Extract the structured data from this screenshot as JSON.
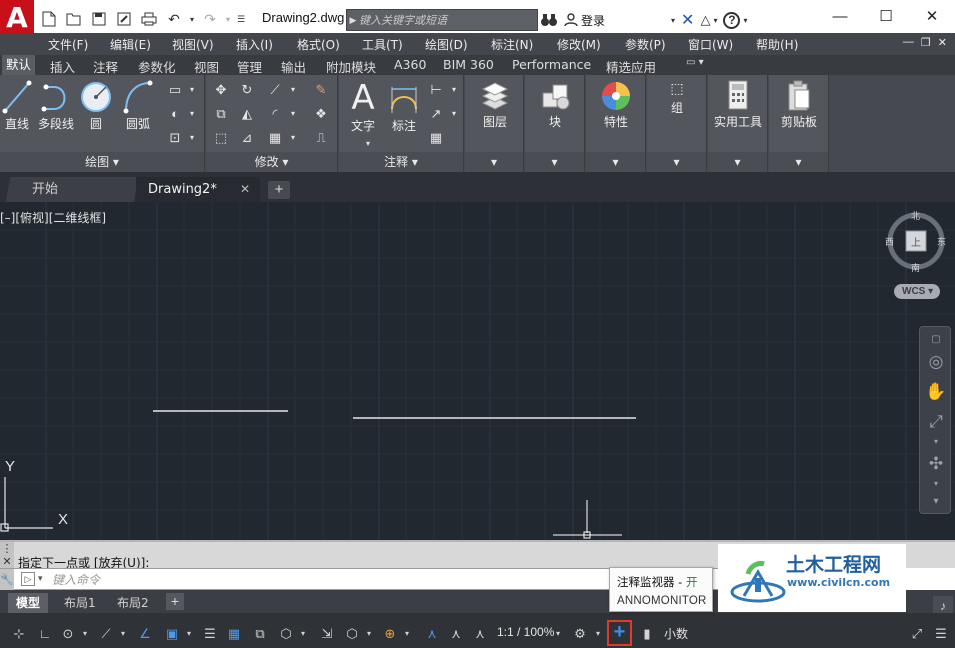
{
  "titlebar": {
    "app_logo": "A",
    "document_title": "Drawing2.dwg",
    "search_placeholder": "键入关键字或短语",
    "login_label": "登录",
    "help_label": "?"
  },
  "menubar": {
    "items": [
      "文件(F)",
      "编辑(E)",
      "视图(V)",
      "插入(I)",
      "格式(O)",
      "工具(T)",
      "绘图(D)",
      "标注(N)",
      "修改(M)",
      "参数(P)",
      "窗口(W)",
      "帮助(H)"
    ]
  },
  "ribbon_tabs": [
    "默认",
    "插入",
    "注释",
    "参数化",
    "视图",
    "管理",
    "输出",
    "附加模块",
    "A360",
    "BIM 360",
    "Performance",
    "精选应用"
  ],
  "ribbon": {
    "draw_panel": {
      "title": "绘图",
      "tools": [
        "直线",
        "多段线",
        "圆",
        "圆弧"
      ]
    },
    "modify_panel": {
      "title": "修改"
    },
    "annotation_panel": {
      "title": "注释",
      "tools": [
        "文字",
        "标注"
      ]
    },
    "layers": "图层",
    "block": "块",
    "properties": "特性",
    "group": "组",
    "utilities": "实用工具",
    "clipboard": "剪贴板"
  },
  "file_tabs": {
    "start": "开始",
    "drawing": "Drawing2*",
    "close": "✕",
    "add": "+"
  },
  "viewport": {
    "label": "[–][俯视][二维线框]",
    "viewcube": {
      "north": "北",
      "south": "南",
      "east": "东",
      "west": "西",
      "face": "上"
    },
    "wcs": "WCS",
    "ucs_x": "X",
    "ucs_y": "Y"
  },
  "command": {
    "history": "指定下一点或 [放弃(U)]:",
    "placeholder": "键入命令"
  },
  "layout_tabs": [
    "模型",
    "布局1",
    "布局2"
  ],
  "statusbar": {
    "scale": "1:1 / 100%",
    "units": "小数"
  },
  "tooltip": {
    "title": "注释监视器 - ",
    "state": "开",
    "command": "ANNOMONITOR"
  },
  "watermark": {
    "brand": "土木工程网",
    "url": "www.civilcn.com"
  },
  "colors": {
    "canvas": "#212830",
    "ribbon": "#53565c",
    "accent_blue": "#3b8ff0",
    "highlight_red": "#e23b2b",
    "logo_red": "#c8101a"
  }
}
